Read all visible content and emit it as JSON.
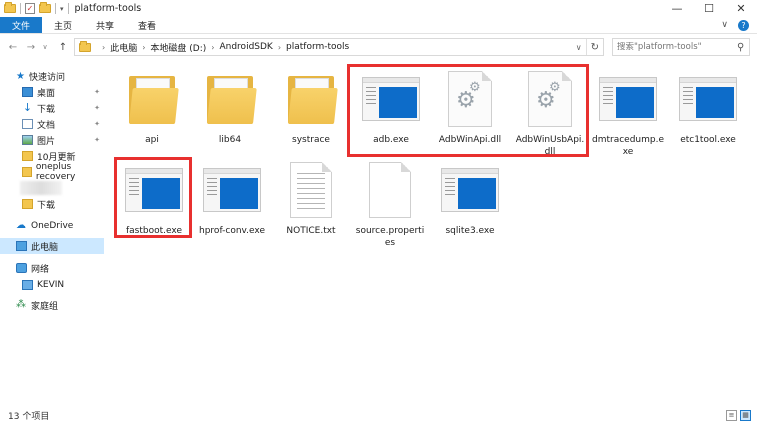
{
  "window": {
    "title": "platform-tools",
    "controls": {
      "minimize": "—",
      "maximize": "☐",
      "close": "✕"
    }
  },
  "ribbon": {
    "tabs": [
      "文件",
      "主页",
      "共享",
      "查看"
    ],
    "expand": "∨",
    "help": "?"
  },
  "nav": {
    "back": "←",
    "forward": "→",
    "recent": "∨",
    "up": "↑",
    "breadcrumb": [
      "此电脑",
      "本地磁盘 (D:)",
      "AndroidSDK",
      "platform-tools"
    ],
    "search_placeholder": "搜索\"platform-tools\""
  },
  "sidebar": {
    "quick_access": "快速访问",
    "items": [
      {
        "label": "桌面",
        "icon": "desktop-icon",
        "pinned": true
      },
      {
        "label": "下载",
        "icon": "download-icon",
        "pinned": true
      },
      {
        "label": "文档",
        "icon": "document-icon",
        "pinned": true
      },
      {
        "label": "图片",
        "icon": "picture-icon",
        "pinned": true
      },
      {
        "label": "10月更新",
        "icon": "folder-icon",
        "pinned": false
      },
      {
        "label": "oneplus recovery",
        "icon": "folder-icon",
        "pinned": false
      },
      {
        "label": "下载",
        "icon": "folder-icon",
        "pinned": false
      }
    ],
    "onedrive": "OneDrive",
    "this_pc": "此电脑",
    "network": "网络",
    "kevin": "KEVIN",
    "homegroup": "家庭组"
  },
  "files": [
    {
      "name": "api",
      "type": "folder"
    },
    {
      "name": "lib64",
      "type": "folder"
    },
    {
      "name": "systrace",
      "type": "folder"
    },
    {
      "name": "adb.exe",
      "type": "exe"
    },
    {
      "name": "AdbWinApi.dll",
      "type": "dll"
    },
    {
      "name": "AdbWinUsbApi.dll",
      "type": "dll"
    },
    {
      "name": "dmtracedump.exe",
      "type": "exe"
    },
    {
      "name": "etc1tool.exe",
      "type": "exe"
    },
    {
      "name": "fastboot.exe",
      "type": "exe"
    },
    {
      "name": "hprof-conv.exe",
      "type": "exe"
    },
    {
      "name": "NOTICE.txt",
      "type": "txt"
    },
    {
      "name": "source.properties",
      "type": "properties"
    },
    {
      "name": "sqlite3.exe",
      "type": "exe"
    }
  ],
  "status": {
    "count": "13 个项目"
  },
  "colors": {
    "accent": "#1979ca",
    "highlight": "#e8302f",
    "selected": "#cce8ff"
  }
}
